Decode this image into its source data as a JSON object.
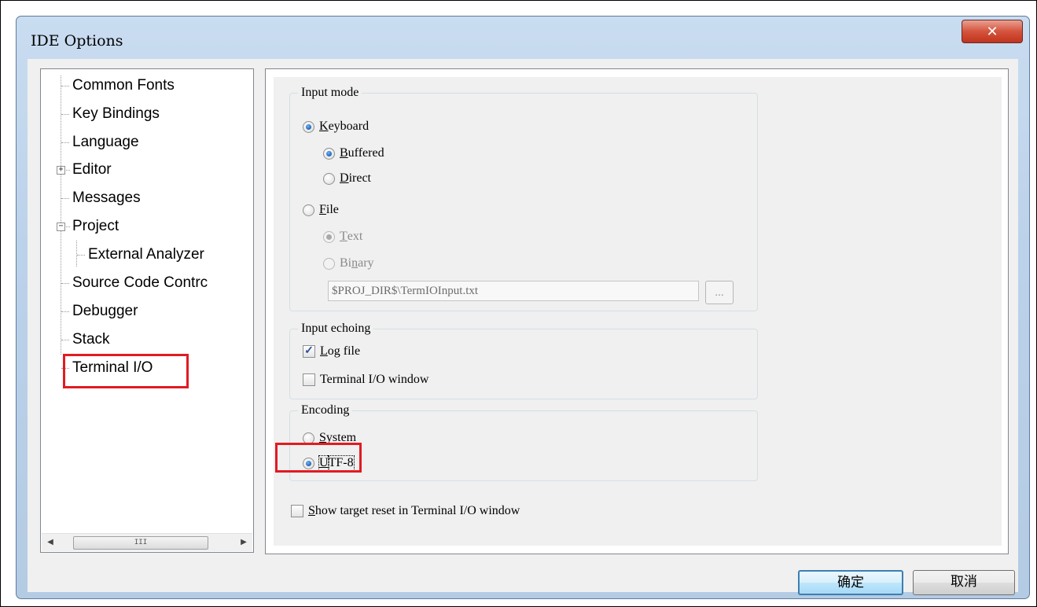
{
  "window": {
    "title": "IDE Options",
    "close_glyph": "✕"
  },
  "tree": {
    "items": [
      {
        "label": "Common Fonts"
      },
      {
        "label": "Key Bindings"
      },
      {
        "label": "Language"
      },
      {
        "label": "Editor",
        "expander": "+"
      },
      {
        "label": "Messages"
      },
      {
        "label": "Project",
        "expander": "−"
      },
      {
        "label": "External Analyzer"
      },
      {
        "label": "Source Code Contrc"
      },
      {
        "label": "Debugger"
      },
      {
        "label": "Stack"
      },
      {
        "label": "Terminal I/O",
        "selected": true
      }
    ],
    "scroll_left": "◀",
    "scroll_right": "▶",
    "scroll_grip": "III"
  },
  "input_mode": {
    "label": "Input mode",
    "keyboard": {
      "u": "K",
      "rest": "eyboard",
      "checked": true
    },
    "buffered": {
      "u": "B",
      "rest": "uffered",
      "checked": true
    },
    "direct": {
      "u": "D",
      "rest": "irect",
      "checked": false
    },
    "file": {
      "u": "F",
      "rest": "ile",
      "checked": false
    },
    "text": {
      "u": "T",
      "rest": "ext",
      "checked": true,
      "disabled": true
    },
    "binary": {
      "pre": "Bi",
      "u": "n",
      "rest": "ary",
      "checked": false,
      "disabled": true
    },
    "path_value": "$PROJ_DIR$\\TermIOInput.txt",
    "browse_label": "..."
  },
  "input_echoing": {
    "label": "Input echoing",
    "log_file": {
      "u": "L",
      "rest": "og file",
      "checked": true
    },
    "terminal_window": {
      "label": "Terminal I/O window",
      "checked": false
    }
  },
  "encoding": {
    "label": "Encoding",
    "system": {
      "u": "S",
      "rest": "ystem",
      "checked": false
    },
    "utf8": {
      "u": "U",
      "rest": "TF-8",
      "checked": true
    }
  },
  "show_reset": {
    "u": "S",
    "rest": "how target reset in Terminal I/O window",
    "checked": false
  },
  "buttons": {
    "ok": "确定",
    "cancel": "取消"
  },
  "check_glyph": "✓",
  "colors": {
    "highlight_box": "#e21b22",
    "radio_checked": "#1f62b4"
  }
}
